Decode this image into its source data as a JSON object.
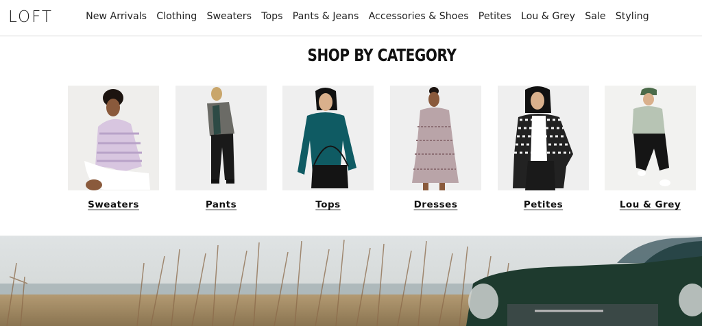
{
  "header": {
    "logo": "LOFT",
    "nav": [
      "New Arrivals",
      "Clothing",
      "Sweaters",
      "Tops",
      "Pants & Jeans",
      "Accessories & Shoes",
      "Petites",
      "Lou & Grey",
      "Sale",
      "Styling"
    ]
  },
  "section": {
    "title": "SHOP BY CATEGORY"
  },
  "categories": [
    {
      "label": "Sweaters"
    },
    {
      "label": "Pants"
    },
    {
      "label": "Tops"
    },
    {
      "label": "Dresses"
    },
    {
      "label": "Petites"
    },
    {
      "label": "Lou & Grey"
    }
  ],
  "colors": {
    "text": "#1a1a1a",
    "divider": "#d6d6d6",
    "tile_bg": "#efefef",
    "car_green": "#1e3a2e"
  }
}
